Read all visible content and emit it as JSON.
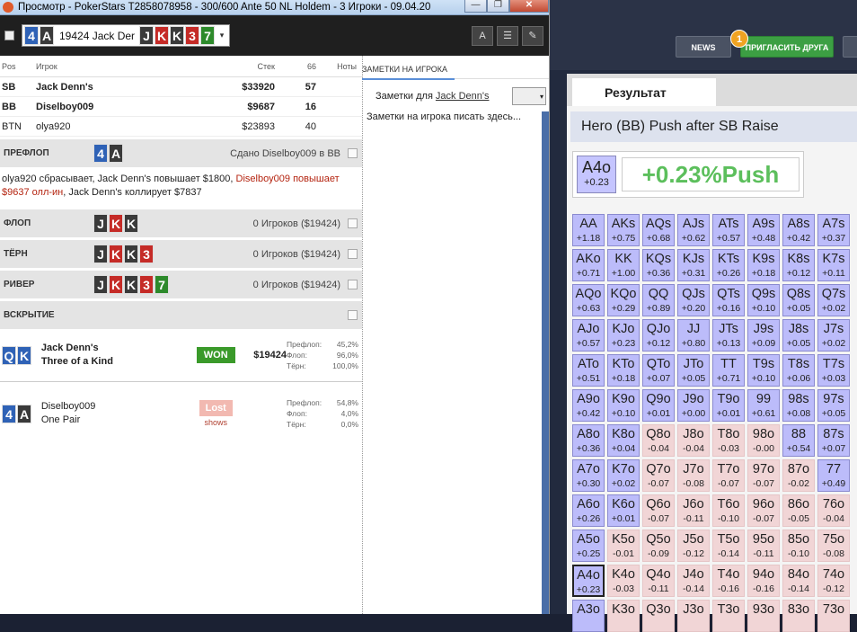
{
  "window": {
    "title": "Просмотр - PokerStars T2858078958 - 300/600 Ante 50 NL Holdem - 3 Игроки - 09.04.20",
    "buttons": [
      "—",
      "❐",
      "✕"
    ]
  },
  "toolbar": {
    "hand_cards": [
      {
        "rank": "4",
        "suit": "d"
      },
      {
        "rank": "A",
        "suit": "s"
      }
    ],
    "hand_label": "19424 Jack Der",
    "board": [
      {
        "rank": "J",
        "suit": "s"
      },
      {
        "rank": "K",
        "suit": "h"
      },
      {
        "rank": "K",
        "suit": "s"
      },
      {
        "rank": "3",
        "suit": "h"
      },
      {
        "rank": "7",
        "suit": "c"
      }
    ],
    "dropdown_icon": "▾",
    "tools": [
      {
        "name": "font-size-icon",
        "glyph": "A"
      },
      {
        "name": "list-icon",
        "glyph": "☰"
      },
      {
        "name": "edit-icon",
        "glyph": "✎"
      }
    ]
  },
  "players_header": {
    "pos": "Pos",
    "player": "Игрок",
    "stack": "Стек",
    "vpip": "66",
    "notes": "Ноты"
  },
  "players": [
    {
      "pos": "SB",
      "name": "Jack Denn's",
      "stack": "$33920",
      "vpip": "57",
      "bold": true
    },
    {
      "pos": "BB",
      "name": "Diselboy009",
      "stack": "$9687",
      "vpip": "16",
      "bold": true
    },
    {
      "pos": "BTN",
      "name": "olya920",
      "stack": "$23893",
      "vpip": "40",
      "bold": false
    }
  ],
  "preflop": {
    "label": "ПРЕФЛОП",
    "cards": [
      {
        "rank": "4",
        "suit": "d"
      },
      {
        "rank": "A",
        "suit": "s"
      }
    ],
    "info": "Сдано Diselboy009 в BB",
    "action_1": "olya920 сбрасывает, Jack Denn's повышает $1800, ",
    "action_2": "Diselboy009 повышает $9637 олл-ин",
    "action_3": ", Jack Denn's коллирует $7837"
  },
  "flop": {
    "label": "ФЛОП",
    "cards": [
      {
        "rank": "J",
        "suit": "s"
      },
      {
        "rank": "K",
        "suit": "h"
      },
      {
        "rank": "K",
        "suit": "s"
      }
    ],
    "info": "0 Игроков ($19424)"
  },
  "turn": {
    "label": "ТЁРН",
    "cards": [
      {
        "rank": "J",
        "suit": "s"
      },
      {
        "rank": "K",
        "suit": "h"
      },
      {
        "rank": "K",
        "suit": "s"
      },
      {
        "rank": "3",
        "suit": "h"
      }
    ],
    "info": "0 Игроков ($19424)"
  },
  "river": {
    "label": "РИВЕР",
    "cards": [
      {
        "rank": "J",
        "suit": "s"
      },
      {
        "rank": "K",
        "suit": "h"
      },
      {
        "rank": "K",
        "suit": "s"
      },
      {
        "rank": "3",
        "suit": "h"
      },
      {
        "rank": "7",
        "suit": "c"
      }
    ],
    "info": "0 Игроков ($19424)"
  },
  "showdown_label": "ВСКРЫТИЕ",
  "showdown": [
    {
      "cards": [
        {
          "rank": "Q",
          "suit": "d"
        },
        {
          "rank": "K",
          "suit": "d"
        }
      ],
      "name": "Jack Denn's",
      "hand": "Three of a Kind",
      "result": "WON",
      "amount": "$19424",
      "shows": "",
      "eq": [
        [
          "Префлоп:",
          "45,2%"
        ],
        [
          "Флоп:",
          "96,0%"
        ],
        [
          "Тёрн:",
          "100,0%"
        ]
      ]
    },
    {
      "cards": [
        {
          "rank": "4",
          "suit": "d"
        },
        {
          "rank": "A",
          "suit": "s"
        }
      ],
      "name": "Diselboy009",
      "hand": "One Pair",
      "result": "Lost",
      "amount": "",
      "shows": "shows",
      "eq": [
        [
          "Префлоп:",
          "54,8%"
        ],
        [
          "Флоп:",
          "4,0%"
        ],
        [
          "Тёрн:",
          "0,0%"
        ]
      ]
    }
  ],
  "notes": {
    "tab": "ЗАМЕТКИ НА ИГРОКА",
    "for_label": "Заметки для",
    "for_player": "Jack Denn's",
    "placeholder": "Заметки на игрока писать здесь..."
  },
  "app": {
    "news": "NEWS",
    "invite": "ПРИГЛАСИТЬ ДРУГА",
    "badge": "1",
    "result_tab": "Результат",
    "scenario": "Hero (BB) Push after SB Raise",
    "hand": "A4o",
    "hand_ev": "+0.23",
    "result": "+0.23%Push"
  },
  "range_grid": [
    [
      [
        "AA",
        "+1.18",
        "p"
      ],
      [
        "AKs",
        "+0.75",
        "p"
      ],
      [
        "AQs",
        "+0.68",
        "p"
      ],
      [
        "AJs",
        "+0.62",
        "p"
      ],
      [
        "ATs",
        "+0.57",
        "p"
      ],
      [
        "A9s",
        "+0.48",
        "p"
      ],
      [
        "A8s",
        "+0.42",
        "p"
      ],
      [
        "A7s",
        "+0.37",
        "p"
      ]
    ],
    [
      [
        "AKo",
        "+0.71",
        "p"
      ],
      [
        "KK",
        "+1.00",
        "p"
      ],
      [
        "KQs",
        "+0.36",
        "p"
      ],
      [
        "KJs",
        "+0.31",
        "p"
      ],
      [
        "KTs",
        "+0.26",
        "p"
      ],
      [
        "K9s",
        "+0.18",
        "p"
      ],
      [
        "K8s",
        "+0.12",
        "p"
      ],
      [
        "K7s",
        "+0.11",
        "p"
      ]
    ],
    [
      [
        "AQo",
        "+0.63",
        "p"
      ],
      [
        "KQo",
        "+0.29",
        "p"
      ],
      [
        "QQ",
        "+0.89",
        "p"
      ],
      [
        "QJs",
        "+0.20",
        "p"
      ],
      [
        "QTs",
        "+0.16",
        "p"
      ],
      [
        "Q9s",
        "+0.10",
        "p"
      ],
      [
        "Q8s",
        "+0.05",
        "p"
      ],
      [
        "Q7s",
        "+0.02",
        "p"
      ]
    ],
    [
      [
        "AJo",
        "+0.57",
        "p"
      ],
      [
        "KJo",
        "+0.23",
        "p"
      ],
      [
        "QJo",
        "+0.12",
        "p"
      ],
      [
        "JJ",
        "+0.80",
        "p"
      ],
      [
        "JTs",
        "+0.13",
        "p"
      ],
      [
        "J9s",
        "+0.09",
        "p"
      ],
      [
        "J8s",
        "+0.05",
        "p"
      ],
      [
        "J7s",
        "+0.02",
        "p"
      ]
    ],
    [
      [
        "ATo",
        "+0.51",
        "p"
      ],
      [
        "KTo",
        "+0.18",
        "p"
      ],
      [
        "QTo",
        "+0.07",
        "p"
      ],
      [
        "JTo",
        "+0.05",
        "p"
      ],
      [
        "TT",
        "+0.71",
        "p"
      ],
      [
        "T9s",
        "+0.10",
        "p"
      ],
      [
        "T8s",
        "+0.06",
        "p"
      ],
      [
        "T7s",
        "+0.03",
        "p"
      ]
    ],
    [
      [
        "A9o",
        "+0.42",
        "p"
      ],
      [
        "K9o",
        "+0.10",
        "p"
      ],
      [
        "Q9o",
        "+0.01",
        "p"
      ],
      [
        "J9o",
        "+0.00",
        "p"
      ],
      [
        "T9o",
        "+0.01",
        "p"
      ],
      [
        "99",
        "+0.61",
        "p"
      ],
      [
        "98s",
        "+0.08",
        "p"
      ],
      [
        "97s",
        "+0.05",
        "p"
      ]
    ],
    [
      [
        "A8o",
        "+0.36",
        "p"
      ],
      [
        "K8o",
        "+0.04",
        "p"
      ],
      [
        "Q8o",
        "-0.04",
        "f"
      ],
      [
        "J8o",
        "-0.04",
        "f"
      ],
      [
        "T8o",
        "-0.03",
        "f"
      ],
      [
        "98o",
        "-0.00",
        "f"
      ],
      [
        "88",
        "+0.54",
        "p"
      ],
      [
        "87s",
        "+0.07",
        "p"
      ]
    ],
    [
      [
        "A7o",
        "+0.30",
        "p"
      ],
      [
        "K7o",
        "+0.02",
        "p"
      ],
      [
        "Q7o",
        "-0.07",
        "f"
      ],
      [
        "J7o",
        "-0.08",
        "f"
      ],
      [
        "T7o",
        "-0.07",
        "f"
      ],
      [
        "97o",
        "-0.07",
        "f"
      ],
      [
        "87o",
        "-0.02",
        "f"
      ],
      [
        "77",
        "+0.49",
        "p"
      ]
    ],
    [
      [
        "A6o",
        "+0.26",
        "p"
      ],
      [
        "K6o",
        "+0.01",
        "p"
      ],
      [
        "Q6o",
        "-0.07",
        "f"
      ],
      [
        "J6o",
        "-0.11",
        "f"
      ],
      [
        "T6o",
        "-0.10",
        "f"
      ],
      [
        "96o",
        "-0.07",
        "f"
      ],
      [
        "86o",
        "-0.05",
        "f"
      ],
      [
        "76o",
        "-0.04",
        "f"
      ]
    ],
    [
      [
        "A5o",
        "+0.25",
        "p"
      ],
      [
        "K5o",
        "-0.01",
        "f"
      ],
      [
        "Q5o",
        "-0.09",
        "f"
      ],
      [
        "J5o",
        "-0.12",
        "f"
      ],
      [
        "T5o",
        "-0.14",
        "f"
      ],
      [
        "95o",
        "-0.11",
        "f"
      ],
      [
        "85o",
        "-0.10",
        "f"
      ],
      [
        "75o",
        "-0.08",
        "f"
      ]
    ],
    [
      [
        "A4o",
        "+0.23",
        "p"
      ],
      [
        "K4o",
        "-0.03",
        "f"
      ],
      [
        "Q4o",
        "-0.11",
        "f"
      ],
      [
        "J4o",
        "-0.14",
        "f"
      ],
      [
        "T4o",
        "-0.16",
        "f"
      ],
      [
        "94o",
        "-0.16",
        "f"
      ],
      [
        "84o",
        "-0.14",
        "f"
      ],
      [
        "74o",
        "-0.12",
        "f"
      ]
    ],
    [
      [
        "A3o",
        "",
        "p"
      ],
      [
        "K3o",
        "",
        "f"
      ],
      [
        "Q3o",
        "",
        "f"
      ],
      [
        "J3o",
        "",
        "f"
      ],
      [
        "T3o",
        "",
        "f"
      ],
      [
        "93o",
        "",
        "f"
      ],
      [
        "83o",
        "",
        "f"
      ],
      [
        "73o",
        "",
        "f"
      ]
    ]
  ],
  "colors": {
    "push": "#bcbcfa",
    "fold": "#f1d5d6",
    "won": "#3a9a2a",
    "result_green": "#5cbf5c",
    "invite_green": "#3c9f43",
    "badge": "#f0a322"
  }
}
